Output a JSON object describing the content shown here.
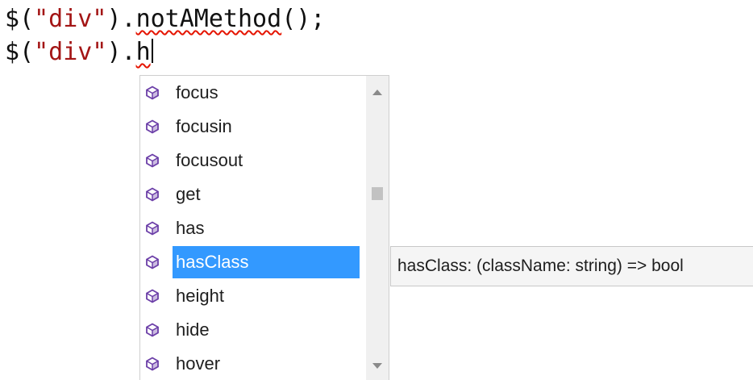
{
  "editor": {
    "line1": {
      "prefix": "$(",
      "string": "\"div\"",
      "dot": ").",
      "method": "notAMethod",
      "suffix": "();"
    },
    "line2": {
      "prefix": "$(",
      "string": "\"div\"",
      "dot": ").",
      "typed": "h"
    }
  },
  "completion": {
    "items": [
      {
        "label": "focus",
        "icon": "method-cube-icon"
      },
      {
        "label": "focusin",
        "icon": "method-cube-icon"
      },
      {
        "label": "focusout",
        "icon": "method-cube-icon"
      },
      {
        "label": "get",
        "icon": "method-cube-icon"
      },
      {
        "label": "has",
        "icon": "method-cube-icon"
      },
      {
        "label": "hasClass",
        "icon": "method-cube-icon",
        "selected": true
      },
      {
        "label": "height",
        "icon": "method-cube-icon"
      },
      {
        "label": "hide",
        "icon": "method-cube-icon"
      },
      {
        "label": "hover",
        "icon": "method-cube-icon"
      }
    ],
    "selected_index": 5
  },
  "tooltip": {
    "text": "hasClass: (className: string) => bool"
  },
  "colors": {
    "selection": "#3399ff",
    "string": "#a31515",
    "error_squiggle": "#e51400",
    "method_icon": "#6c3fa8"
  }
}
